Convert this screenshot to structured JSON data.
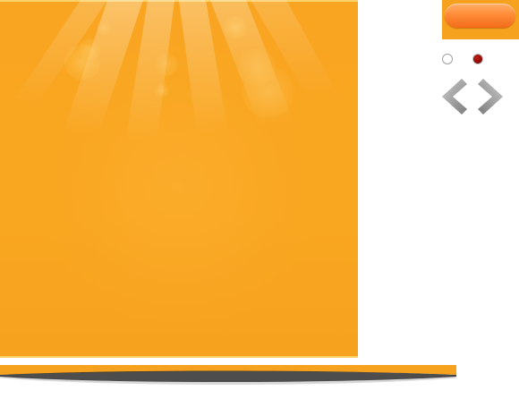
{
  "slider": {
    "panel_color": "#f9a521",
    "accent_button_color": "#ff8c38",
    "shadow_bar_color": "#f7a21e"
  },
  "controls": {
    "button_label": "",
    "prev_icon": "chevron-left-icon",
    "next_icon": "chevron-right-icon",
    "pagination": {
      "total": 2,
      "active_index": 1,
      "inactive_color": "#ffffff",
      "active_color": "#8b0d05"
    }
  }
}
